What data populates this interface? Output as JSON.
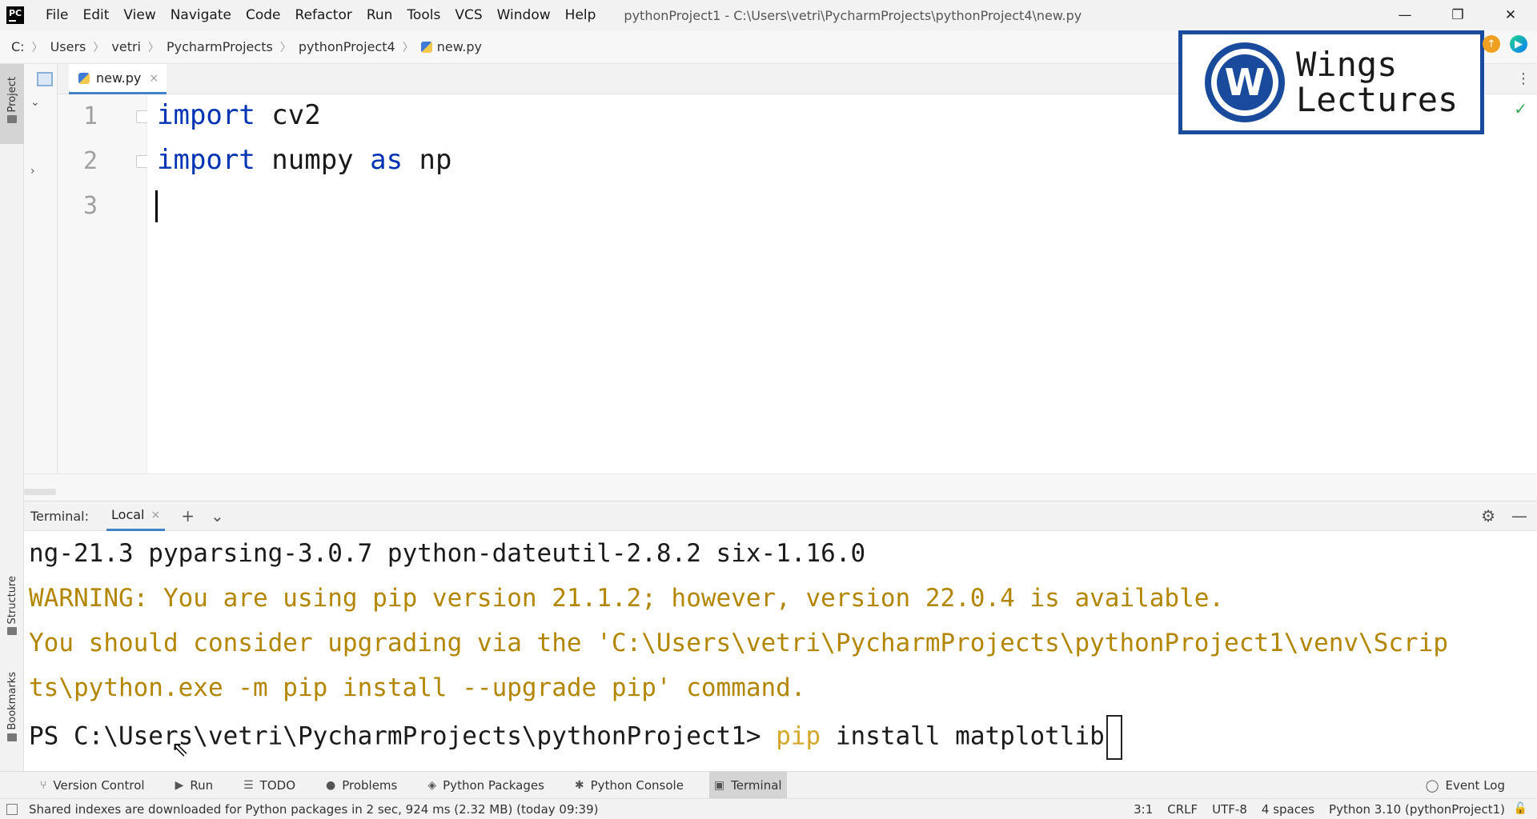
{
  "window": {
    "app_logo": "PC",
    "title": "pythonProject1 - C:\\Users\\vetri\\PycharmProjects\\pythonProject4\\new.py",
    "menu": [
      "File",
      "Edit",
      "View",
      "Navigate",
      "Code",
      "Refactor",
      "Run",
      "Tools",
      "VCS",
      "Window",
      "Help"
    ],
    "controls": {
      "minimize": "—",
      "restore": "❐",
      "close": "✕"
    }
  },
  "breadcrumb": [
    "C:",
    "Users",
    "vetri",
    "PycharmProjects",
    "pythonProject4",
    "new.py"
  ],
  "watermark": {
    "letter": "W",
    "line1": "Wings",
    "line2": "Lectures"
  },
  "left_strip": {
    "project": "Project",
    "structure": "Structure",
    "bookmarks": "Bookmarks"
  },
  "editor": {
    "tab_label": "new.py",
    "tab_close": "×",
    "lines": [
      {
        "num": "1",
        "keyword": "import",
        "rest": " cv2"
      },
      {
        "num": "2",
        "keyword": "import",
        "middle": " numpy ",
        "keyword2": "as",
        "rest": " np"
      },
      {
        "num": "3",
        "text": ""
      }
    ]
  },
  "terminal": {
    "title": "Terminal:",
    "tab": "Local",
    "tab_close": "×",
    "add": "+",
    "dropdown": "⌄",
    "settings": "⚙",
    "hide": "—",
    "lines": [
      "ng-21.3 pyparsing-3.0.7 python-dateutil-2.8.2 six-1.16.0",
      "WARNING: You are using pip version 21.1.2; however, version 22.0.4 is available.",
      "You should consider upgrading via the 'C:\\Users\\vetri\\PycharmProjects\\pythonProject1\\venv\\Scrip",
      "ts\\python.exe -m pip install --upgrade pip' command."
    ],
    "prompt": "PS C:\\Users\\vetri\\PycharmProjects\\pythonProject1> ",
    "command_pip": "pip",
    "command_rest": " install matplotlib"
  },
  "tool_windows": [
    "Version Control",
    "Run",
    "TODO",
    "Problems",
    "Python Packages",
    "Python Console",
    "Terminal"
  ],
  "event_log": "Event Log",
  "status": {
    "message": "Shared indexes are downloaded for Python packages in 2 sec, 924 ms (2.32 MB) (today 09:39)",
    "position": "3:1",
    "line_sep": "CRLF",
    "encoding": "UTF-8",
    "indent": "4 spaces",
    "interpreter": "Python 3.10 (pythonProject1)"
  },
  "colors": {
    "accent": "#4083c9",
    "keyword": "#0033b3",
    "warning": "#b38600",
    "watermark": "#1a4a9c"
  }
}
